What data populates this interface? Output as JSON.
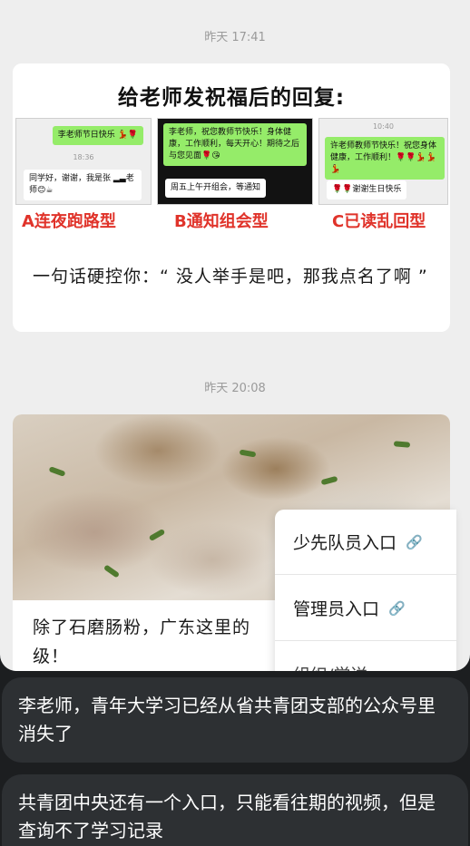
{
  "chat": {
    "timestamp1": "昨天 17:41",
    "timestamp2": "昨天 20:08",
    "card1": {
      "image": {
        "headline": "给老师发祝福后的回复:",
        "panel_a": {
          "bubble1": "李老师节日快乐 💃🌹",
          "time": "18:36",
          "bubble2": "同学好，谢谢，我是张 ▂▃老师😊☕"
        },
        "panel_b": {
          "bubble1": "李老师，祝您教师节快乐！身体健康，工作顺利，每天开心！期待之后与您见面🌹😘",
          "bubble2": "周五上午开组会，等通知"
        },
        "panel_c": {
          "time": "10:40",
          "bubble1": "许老师教师节快乐！祝您身体健康，工作顺利！🌹🌹💃💃💃",
          "bubble2": "🌹🌹谢谢生日快乐"
        },
        "labels": [
          "A连夜跑路型",
          "B通知组会型",
          "C已读乱回型"
        ]
      },
      "title": "一句话硬控你：“ 没人举手是吧，那我点名了啊 ”"
    },
    "card2": {
      "title": "除了石磨肠粉，广东这里的…级！",
      "title_line1": "除了石磨肠粉，广东这里的",
      "title_line2": "级！"
    }
  },
  "popup_menu": {
    "items": [
      {
        "label": "少先队员入口",
        "icon": "link-icon"
      },
      {
        "label": "管理员入口",
        "icon": "link-icon"
      },
      {
        "label": "组织/学送"
      }
    ]
  },
  "messages": [
    {
      "text": "李老师，青年大学习已经从省共青团支部的公众号里消失了"
    },
    {
      "text": "共青团中央还有一个入口，只能看往期的视频，但是查询不了学习记录"
    }
  ],
  "colors": {
    "background_dark": "#1c1e20",
    "chat_panel": "#eeeeee",
    "message_bubble": "#2d3033",
    "label_red": "#e0332a",
    "wechat_green": "#95ec69"
  }
}
